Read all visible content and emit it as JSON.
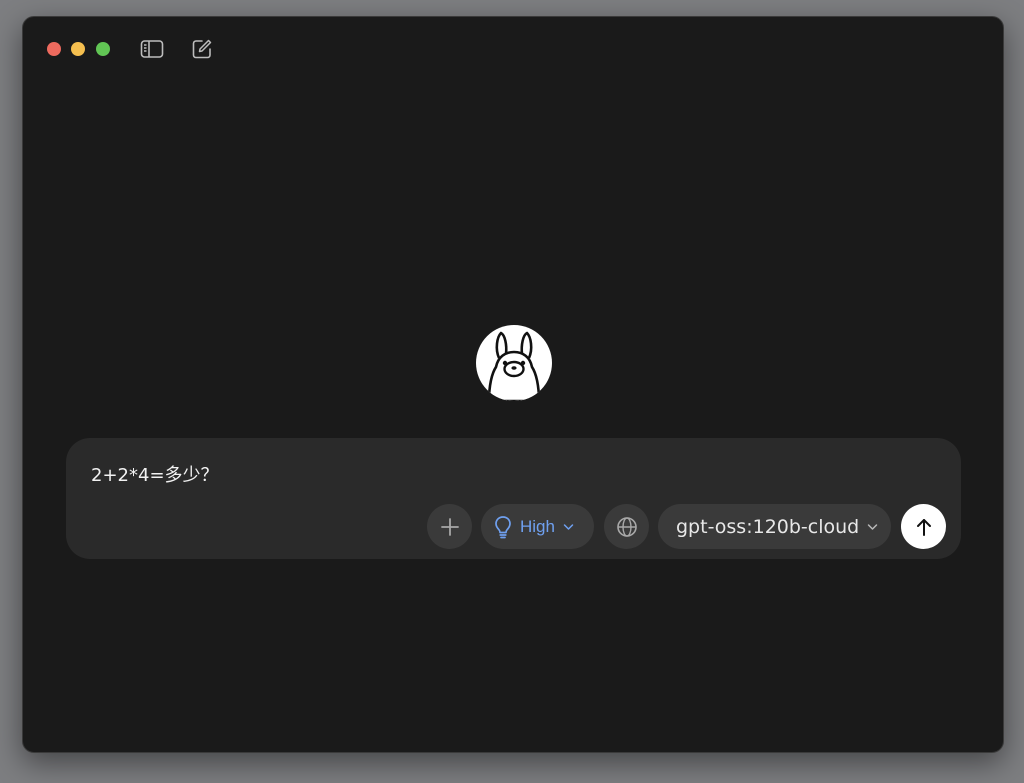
{
  "composer": {
    "message": "2+2*4=多少？"
  },
  "thinking": {
    "level": "High"
  },
  "model": {
    "name": "gpt-oss:120b-cloud"
  },
  "icons": {
    "sidebar_toggle": "sidebar-icon",
    "new_chat": "compose-icon",
    "attach": "plus-icon",
    "thinking": "lightbulb-icon",
    "web_search": "globe-icon",
    "send": "arrow-up-icon",
    "logo": "llama-logo"
  },
  "colors": {
    "accent": "#6fa0f0",
    "window_bg": "#1a1a1a",
    "composer_bg": "#2a2a2a",
    "pill_bg": "#3a3a3a"
  }
}
